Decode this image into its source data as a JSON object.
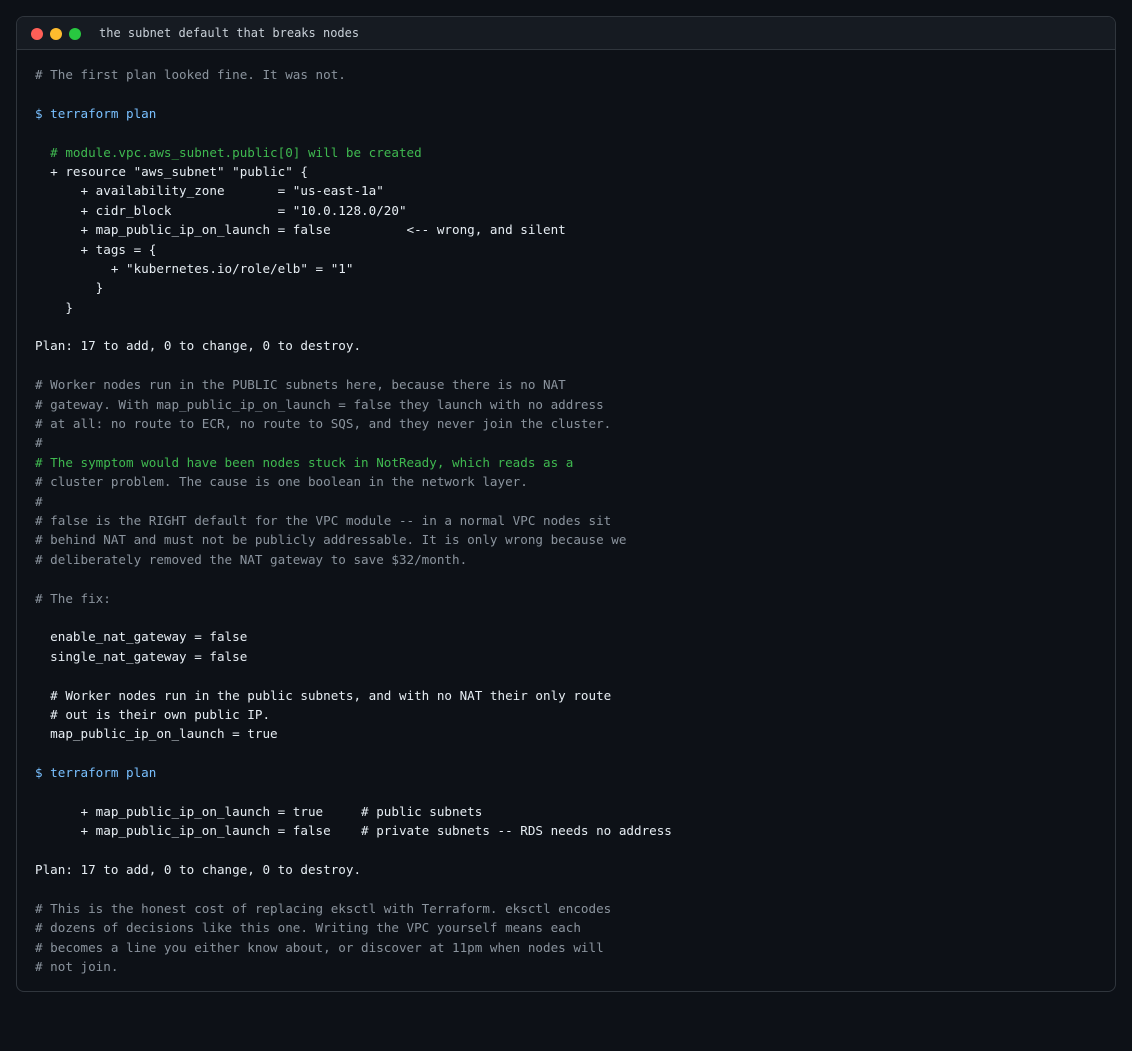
{
  "window": {
    "title": "the subnet default that breaks nodes"
  },
  "terminal": {
    "lines": [
      {
        "text": "# The first plan looked fine. It was not.",
        "style": "comment"
      },
      {
        "text": "",
        "style": "blank"
      },
      {
        "text": "$ terraform plan",
        "style": "command"
      },
      {
        "text": "",
        "style": "blank"
      },
      {
        "text": "  # module.vpc.aws_subnet.public[0] will be created",
        "style": "highlight"
      },
      {
        "text": "  + resource \"aws_subnet\" \"public\" {",
        "style": "output"
      },
      {
        "text": "      + availability_zone       = \"us-east-1a\"",
        "style": "output"
      },
      {
        "text": "      + cidr_block              = \"10.0.128.0/20\"",
        "style": "output"
      },
      {
        "text": "      + map_public_ip_on_launch = false          <-- wrong, and silent",
        "style": "output"
      },
      {
        "text": "      + tags = {",
        "style": "output"
      },
      {
        "text": "          + \"kubernetes.io/role/elb\" = \"1\"",
        "style": "output"
      },
      {
        "text": "        }",
        "style": "output"
      },
      {
        "text": "    }",
        "style": "output"
      },
      {
        "text": "",
        "style": "blank"
      },
      {
        "text": "Plan: 17 to add, 0 to change, 0 to destroy.",
        "style": "output"
      },
      {
        "text": "",
        "style": "blank"
      },
      {
        "text": "# Worker nodes run in the PUBLIC subnets here, because there is no NAT",
        "style": "comment"
      },
      {
        "text": "# gateway. With map_public_ip_on_launch = false they launch with no address",
        "style": "comment"
      },
      {
        "text": "# at all: no route to ECR, no route to SQS, and they never join the cluster.",
        "style": "comment"
      },
      {
        "text": "#",
        "style": "comment"
      },
      {
        "text": "# The symptom would have been nodes stuck in NotReady, which reads as a",
        "style": "highlight"
      },
      {
        "text": "# cluster problem. The cause is one boolean in the network layer.",
        "style": "comment"
      },
      {
        "text": "#",
        "style": "comment"
      },
      {
        "text": "# false is the RIGHT default for the VPC module -- in a normal VPC nodes sit",
        "style": "comment"
      },
      {
        "text": "# behind NAT and must not be publicly addressable. It is only wrong because we",
        "style": "comment"
      },
      {
        "text": "# deliberately removed the NAT gateway to save $32/month.",
        "style": "comment"
      },
      {
        "text": "",
        "style": "blank"
      },
      {
        "text": "# The fix:",
        "style": "comment"
      },
      {
        "text": "",
        "style": "blank"
      },
      {
        "text": "  enable_nat_gateway = false",
        "style": "output"
      },
      {
        "text": "  single_nat_gateway = false",
        "style": "output"
      },
      {
        "text": "",
        "style": "blank"
      },
      {
        "text": "  # Worker nodes run in the public subnets, and with no NAT their only route",
        "style": "output"
      },
      {
        "text": "  # out is their own public IP.",
        "style": "output"
      },
      {
        "text": "  map_public_ip_on_launch = true",
        "style": "output"
      },
      {
        "text": "",
        "style": "blank"
      },
      {
        "text": "$ terraform plan",
        "style": "command"
      },
      {
        "text": "",
        "style": "blank"
      },
      {
        "text": "      + map_public_ip_on_launch = true     # public subnets",
        "style": "output"
      },
      {
        "text": "      + map_public_ip_on_launch = false    # private subnets -- RDS needs no address",
        "style": "output"
      },
      {
        "text": "",
        "style": "blank"
      },
      {
        "text": "Plan: 17 to add, 0 to change, 0 to destroy.",
        "style": "output"
      },
      {
        "text": "",
        "style": "blank"
      },
      {
        "text": "# This is the honest cost of replacing eksctl with Terraform. eksctl encodes",
        "style": "comment"
      },
      {
        "text": "# dozens of decisions like this one. Writing the VPC yourself means each",
        "style": "comment"
      },
      {
        "text": "# becomes a line you either know about, or discover at 11pm when nodes will",
        "style": "comment"
      },
      {
        "text": "# not join.",
        "style": "comment"
      }
    ]
  },
  "colors": {
    "background": "#0d1117",
    "comment": "#8b949e",
    "highlight": "#3fb950",
    "command": "#79c0ff",
    "output": "#e6edf3"
  }
}
